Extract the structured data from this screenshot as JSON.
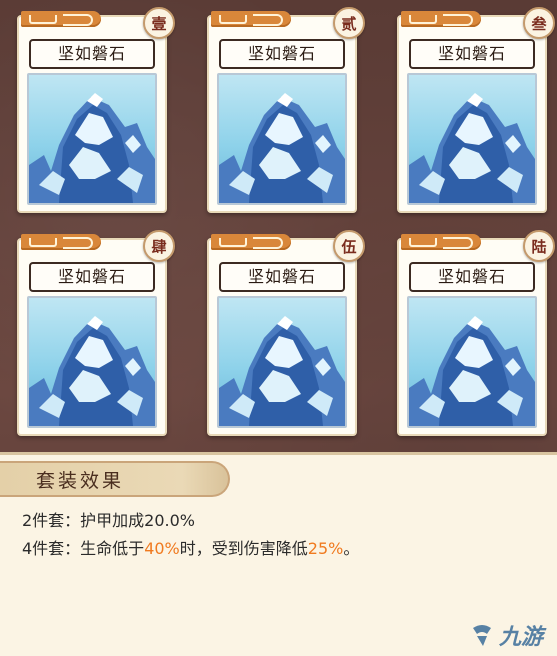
{
  "cards": [
    {
      "name": "坚如磐石",
      "badge": "壹"
    },
    {
      "name": "坚如磐石",
      "badge": "贰"
    },
    {
      "name": "坚如磐石",
      "badge": "叁"
    },
    {
      "name": "坚如磐石",
      "badge": "肆"
    },
    {
      "name": "坚如磐石",
      "badge": "伍"
    },
    {
      "name": "坚如磐石",
      "badge": "陆"
    }
  ],
  "set_effect": {
    "title": "套装效果",
    "line1": {
      "prefix": "2件套：护甲加成20.0%"
    },
    "line2": {
      "part1": "4件套：生命低于",
      "hl1": "40%",
      "part2": "时，受到伤害降低",
      "hl2": "25%",
      "part3": "。"
    }
  },
  "watermark": {
    "text": "九游",
    "icon": "jiuyou-logo-icon"
  },
  "colors": {
    "highlight": "#f07a1f",
    "background": "#5a3b35",
    "panel": "#fbf4e4"
  }
}
